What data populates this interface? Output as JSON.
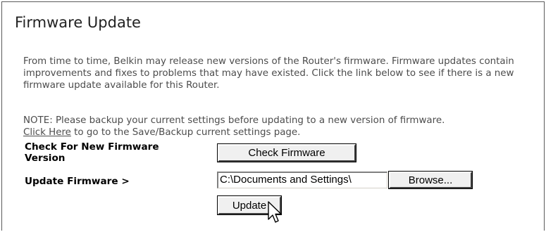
{
  "page": {
    "title": "Firmware Update",
    "intro": "From time to time, Belkin may release new versions of the Router's firmware. Firmware updates contain improvements and fixes to problems that may have existed. Click the link below to see if there is a new firmware update available for this Router.",
    "note_before": "NOTE: Please backup your current settings before updating to a new version of firmware.",
    "note_link": "Click Here",
    "note_after": " to go to the Save/Backup current settings page."
  },
  "form": {
    "check_label": "Check For New Firmware Version",
    "check_button": "Check Firmware",
    "update_label": "Update Firmware >",
    "file_value": "C:\\Documents and Settings\\",
    "browse_button": "Browse...",
    "update_button": "Update"
  },
  "icons": {
    "cursor": "arrow-pointer-icon"
  }
}
